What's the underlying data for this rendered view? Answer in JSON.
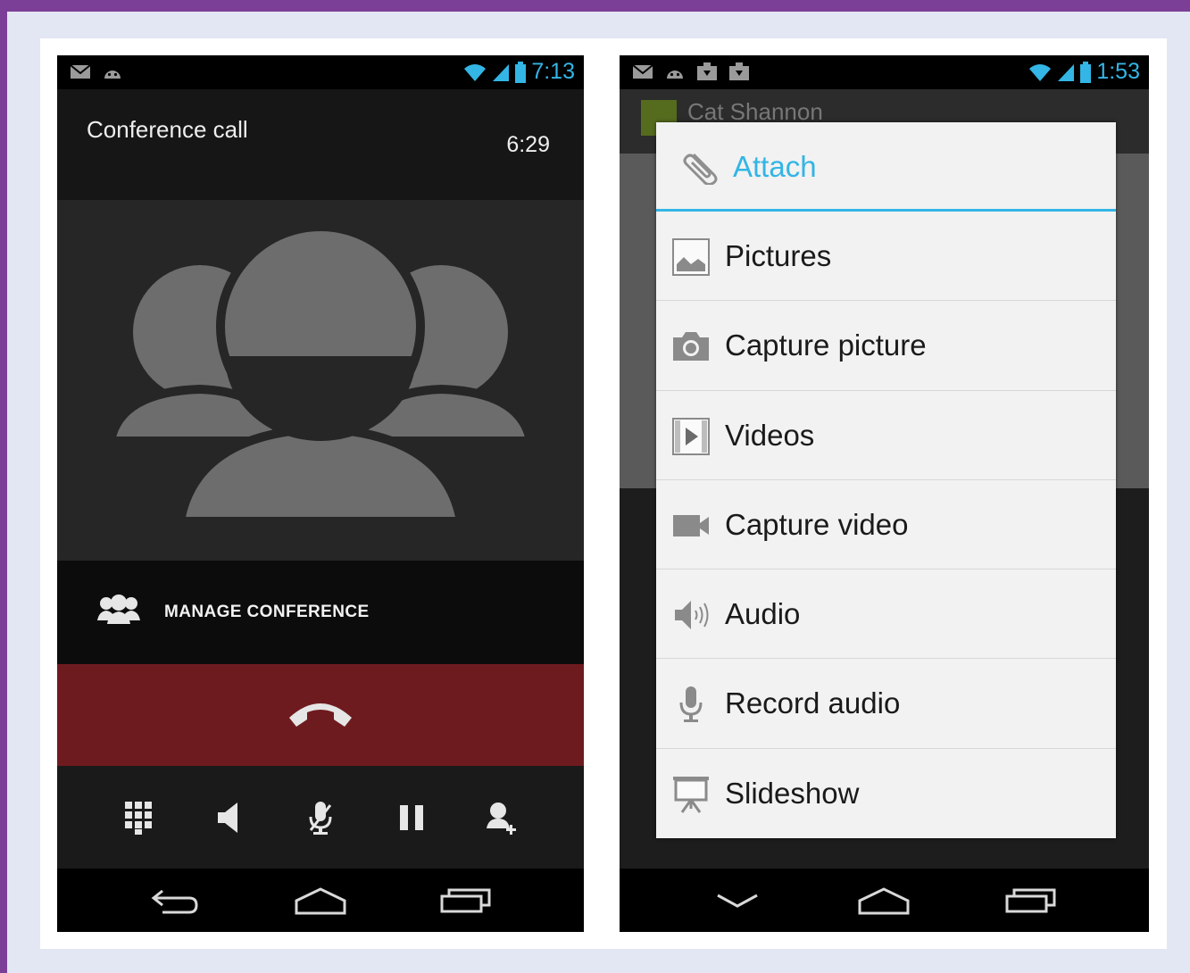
{
  "left_phone": {
    "status": {
      "time": "7:13",
      "time_color": "#33b5e5"
    },
    "call": {
      "title": "Conference call",
      "elapsed": "6:29"
    },
    "manage_label": "MANAGE CONFERENCE",
    "end_call_color": "#6e1b1f",
    "controls": [
      "dialpad-icon",
      "speaker-icon",
      "mute-mic-icon",
      "hold-icon",
      "add-call-icon"
    ],
    "nav": [
      "back-icon",
      "home-icon",
      "recent-apps-icon"
    ]
  },
  "right_phone": {
    "status": {
      "time": "1:53"
    },
    "background": {
      "contact_name": "Cat Shannon"
    },
    "menu": {
      "title": "Attach",
      "title_icon": "paperclip-icon",
      "accent": "#33b5e5",
      "items": [
        {
          "label": "Pictures",
          "icon": "picture-icon"
        },
        {
          "label": "Capture picture",
          "icon": "camera-icon"
        },
        {
          "label": "Videos",
          "icon": "video-file-icon"
        },
        {
          "label": "Capture video",
          "icon": "video-camera-icon"
        },
        {
          "label": "Audio",
          "icon": "audio-icon"
        },
        {
          "label": "Record audio",
          "icon": "microphone-icon"
        },
        {
          "label": "Slideshow",
          "icon": "slideshow-icon"
        }
      ]
    },
    "nav": [
      "hide-keyboard-icon",
      "home-icon",
      "recent-apps-icon"
    ]
  }
}
